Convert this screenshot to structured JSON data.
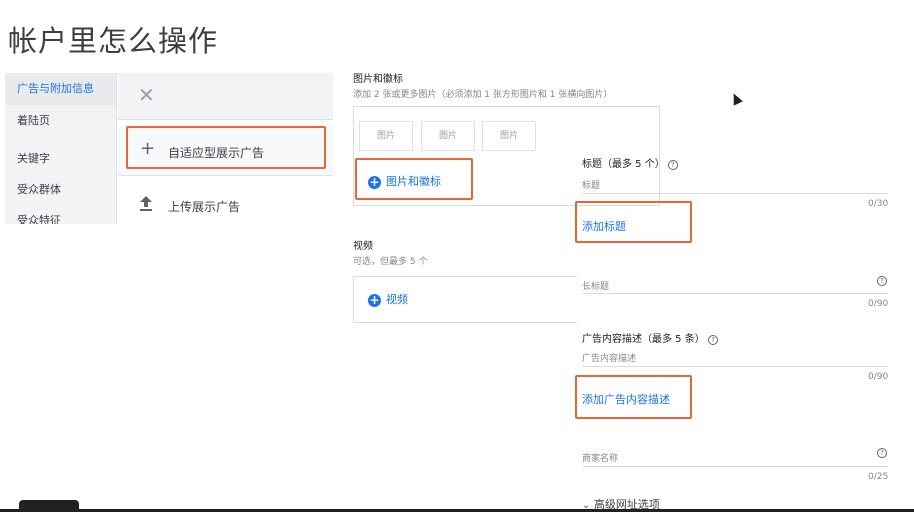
{
  "page_title": "帐户里怎么操作",
  "nav": {
    "items": [
      {
        "label": "广告与附加信息",
        "active": true
      },
      {
        "label": "着陆页"
      },
      {
        "label": "关键字"
      },
      {
        "label": "受众群体"
      },
      {
        "label": "受众特征"
      }
    ]
  },
  "panel": {
    "close_icon": "close-icon",
    "options": [
      {
        "icon": "+",
        "label": "自适应型展示广告"
      },
      {
        "icon": "upload-icon",
        "label": "上传展示广告"
      }
    ]
  },
  "images_section": {
    "title": "图片和徽标",
    "subtitle": "添加 2 张或更多图片（必须添加 1 张方形图片和 1 张横向图片）",
    "thumbs": [
      "图片",
      "图片",
      "图片"
    ],
    "add_label": "图片和徽标"
  },
  "video_section": {
    "title": "视频",
    "subtitle": "可选，但最多 5 个",
    "add_label": "视频"
  },
  "form": {
    "headlines_label": "标题（最多 5 个）",
    "headline_placeholder": "标题",
    "headline_counter": "0/30",
    "add_headline": "添加标题",
    "long_headline_placeholder": "长标题",
    "long_headline_counter": "0/90",
    "descriptions_label": "广告内容描述（最多 5 条）",
    "description_placeholder": "广告内容描述",
    "description_counter": "0/90",
    "add_description": "添加广告内容描述",
    "business_name_placeholder": "商家名称",
    "business_name_counter": "0/25",
    "advanced_url": "高级网址选项",
    "help_glyph": "?"
  },
  "colors": {
    "accent_blue": "#1a73e8",
    "highlight_red": "#e8673a"
  }
}
